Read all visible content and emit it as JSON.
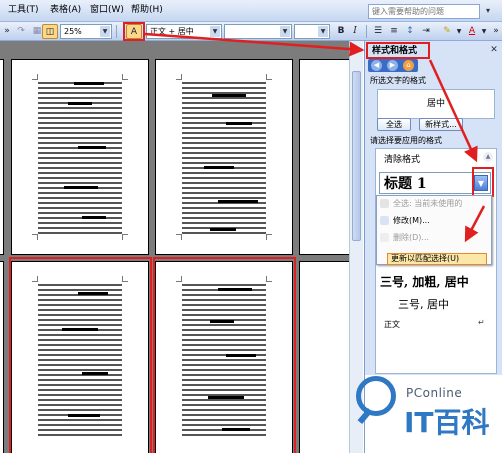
{
  "menubar": {
    "items": [
      "工具(T)",
      "表格(A)",
      "窗口(W)",
      "帮助(H)"
    ],
    "help_placeholder": "键入需要帮助的问题"
  },
  "toolbar": {
    "zoom": "25%",
    "style": "正文 + 居中",
    "bold": "B",
    "italic": "I",
    "font_color": "A"
  },
  "task_pane": {
    "title": "样式和格式",
    "selected_label": "所选文字的格式",
    "selected_value": "居中",
    "select_all": "全选",
    "new_style": "新样式...",
    "apply_label": "请选择要应用的格式",
    "clear_format": "清除格式",
    "heading_combo": "标题 1",
    "menu": {
      "select_all": "全选: 当前未使用的",
      "modify": "修改(M)...",
      "delete": "删除(D)...",
      "update": "更新以匹配选择(U)"
    },
    "list": {
      "item1": "三号, 加粗, 居中",
      "item2": "三号, 居中",
      "item3": "正文"
    }
  },
  "watermark": {
    "small": "PConline",
    "big": "IT百科"
  },
  "colors": {
    "annotation_red": "#e02020",
    "watermark_blue": "#2e78c4"
  }
}
